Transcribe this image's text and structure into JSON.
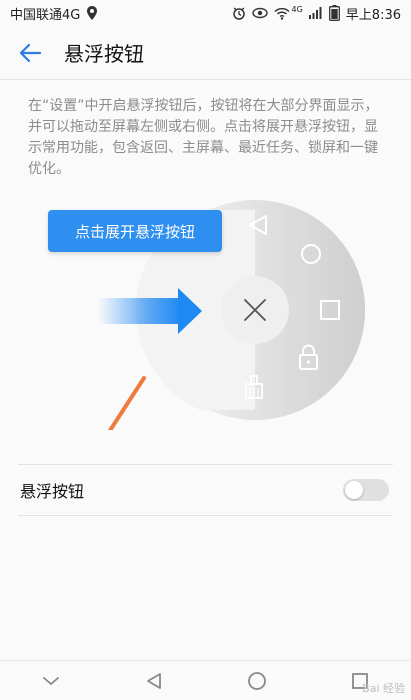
{
  "status_bar": {
    "carrier": "中国联通4G",
    "network_badge": "4G",
    "time": "早上8:36",
    "icons": [
      "alarm-icon",
      "eye-icon",
      "wifi-icon",
      "signal-icon",
      "battery-icon"
    ]
  },
  "header": {
    "back_icon": "back-arrow-icon",
    "title": "悬浮按钮"
  },
  "description": "在“设置”中开启悬浮按钮后，按钮将在大部分界面显示，并可以拖动至屏幕左侧或右侧。点击将展开悬浮按钮，显示常用功能，包含返回、主屏幕、最近任务、锁屏和一键优化。",
  "illustration": {
    "tooltip": "点击展开悬浮按钮",
    "menu_icons": [
      "back-triangle-icon",
      "home-circle-icon",
      "recent-square-icon",
      "lock-icon",
      "broom-icon",
      "close-x-icon"
    ],
    "colors": {
      "tooltip_bg": "#2f8ff0",
      "arrow_blue": "#1e88f5",
      "pointer_orange": "#f07a3c"
    }
  },
  "setting": {
    "label": "悬浮按钮",
    "enabled": false
  },
  "nav_bar": {
    "icons": [
      "chevron-down-icon",
      "nav-back-icon",
      "nav-home-icon",
      "nav-recent-icon"
    ]
  },
  "watermark": "Bai 经验"
}
